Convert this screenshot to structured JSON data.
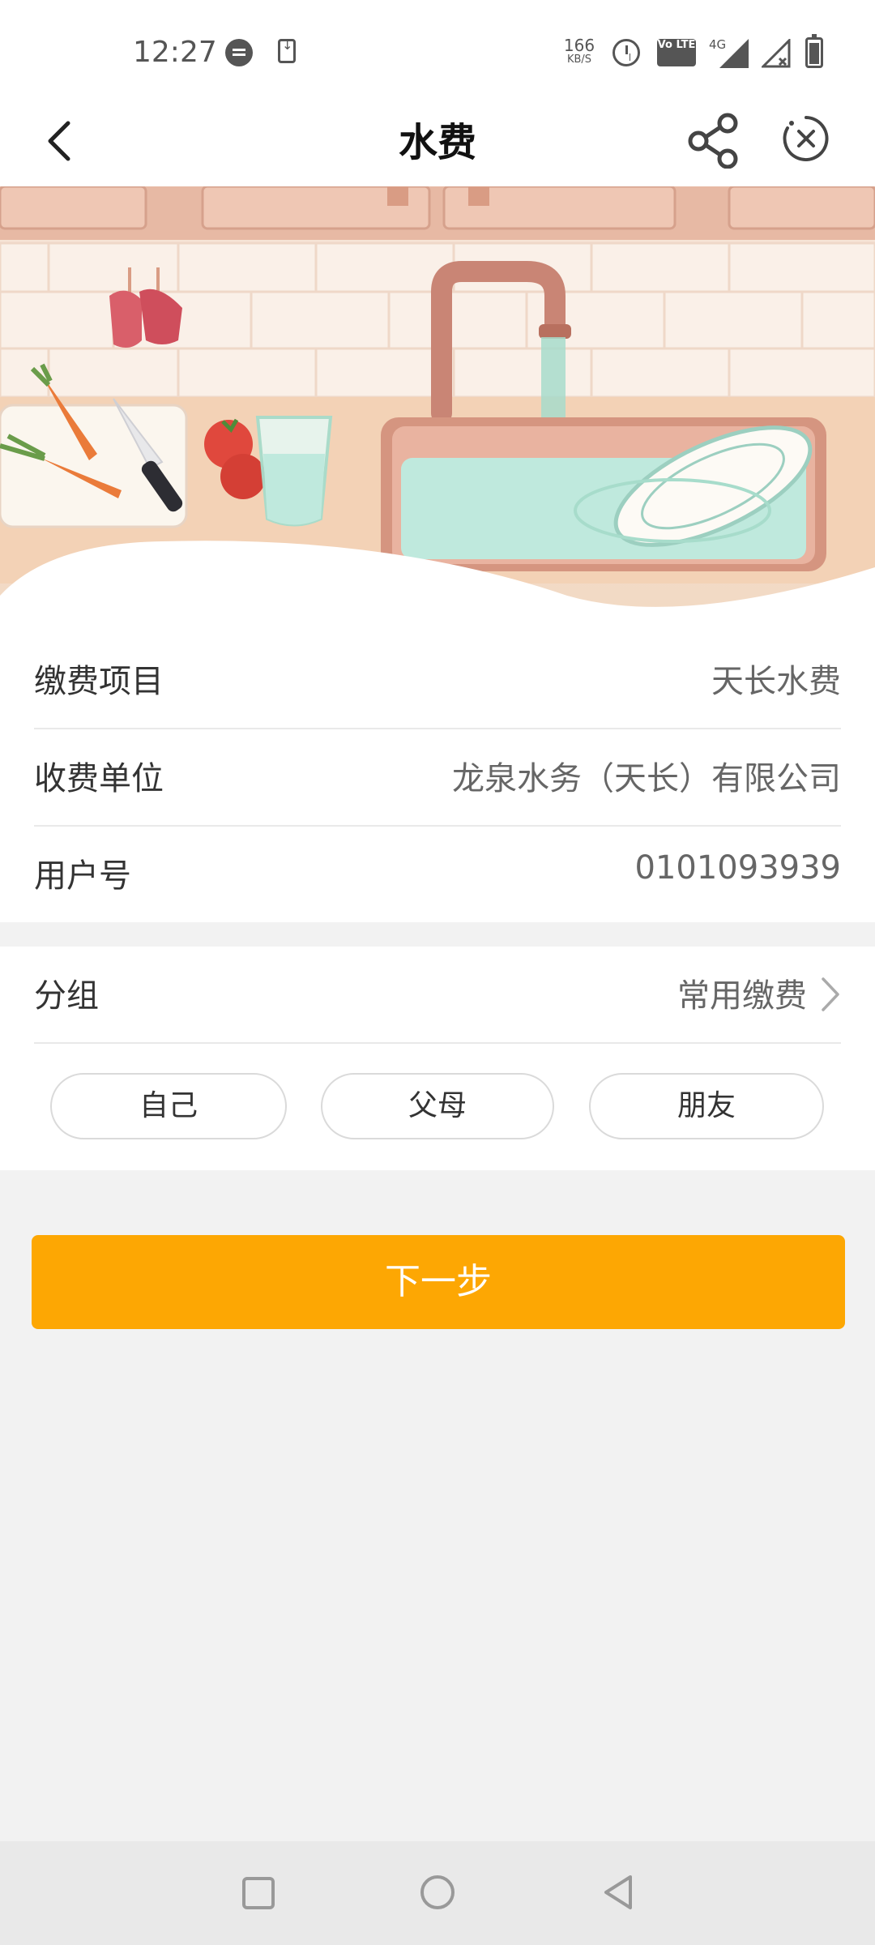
{
  "status_bar": {
    "time": "12:27",
    "net_speed_value": "166",
    "net_speed_unit": "KB/S",
    "volte_label": "Vo LTE",
    "network_label": "4G",
    "icons": [
      "message-icon",
      "download-icon",
      "alarm-icon",
      "volte-icon",
      "signal-icon",
      "signal-no-sim-icon",
      "battery-icon"
    ]
  },
  "nav": {
    "title": "水费",
    "icons": [
      "back-icon",
      "share-icon",
      "close-icon"
    ]
  },
  "banner": {
    "description_icon": "kitchen-sink-illustration"
  },
  "info": {
    "rows": [
      {
        "label": "缴费项目",
        "value": "天长水费"
      },
      {
        "label": "收费单位",
        "value": "龙泉水务（天长）有限公司"
      },
      {
        "label": "用户号",
        "value": "0101093939"
      }
    ]
  },
  "group": {
    "label": "分组",
    "value": "常用缴费",
    "options": [
      "自己",
      "父母",
      "朋友"
    ]
  },
  "actions": {
    "next_label": "下一步"
  },
  "colors": {
    "accent": "#fda703",
    "background": "#f2f2f2"
  }
}
